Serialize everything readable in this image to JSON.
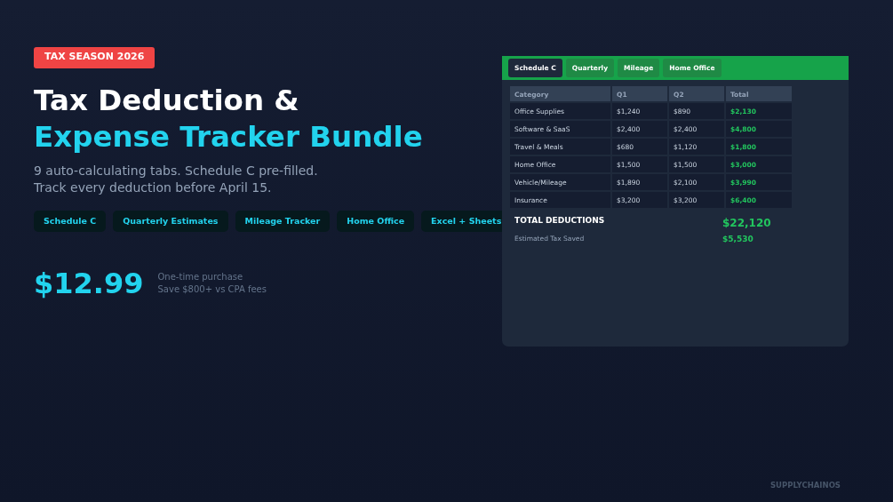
{
  "badge": "TAX SEASON 2026",
  "title": {
    "line_1": "Tax Deduction &",
    "line_2": "Expense Tracker Bundle"
  },
  "subtitle": [
    "9 auto-calculating tabs. Schedule C pre-filled.",
    "Track every deduction before April 15."
  ],
  "features": [
    "Schedule C",
    "Quarterly Estimates",
    "Mileage Tracker",
    "Home Office",
    "Excel + Sheets"
  ],
  "price": {
    "amount": "$12.99",
    "notes": [
      "One-time purchase",
      "Save $800+ vs CPA fees"
    ]
  },
  "spreadsheet": {
    "tabs": [
      {
        "label": "Schedule C",
        "selected": true
      },
      {
        "label": "Quarterly",
        "selected": false
      },
      {
        "label": "Mileage",
        "selected": false
      },
      {
        "label": "Home Office",
        "selected": false
      }
    ],
    "columns": [
      "Category",
      "Q1",
      "Q2",
      "Total"
    ],
    "rows": [
      [
        "Office Supplies",
        "$1,240",
        "$890",
        "$2,130"
      ],
      [
        "Software & SaaS",
        "$2,400",
        "$2,400",
        "$4,800"
      ],
      [
        "Travel & Meals",
        "$680",
        "$1,120",
        "$1,800"
      ],
      [
        "Home Office",
        "$1,500",
        "$1,500",
        "$3,000"
      ],
      [
        "Vehicle/Mileage",
        "$1,890",
        "$2,100",
        "$3,990"
      ],
      [
        "Insurance",
        "$3,200",
        "$3,200",
        "$6,400"
      ]
    ],
    "total": {
      "label": "TOTAL DEDUCTIONS",
      "value": "$22,120"
    },
    "saved": {
      "label": "Estimated Tax Saved",
      "value": "$5,530"
    }
  },
  "brand": "SUPPLYCHAINOS"
}
